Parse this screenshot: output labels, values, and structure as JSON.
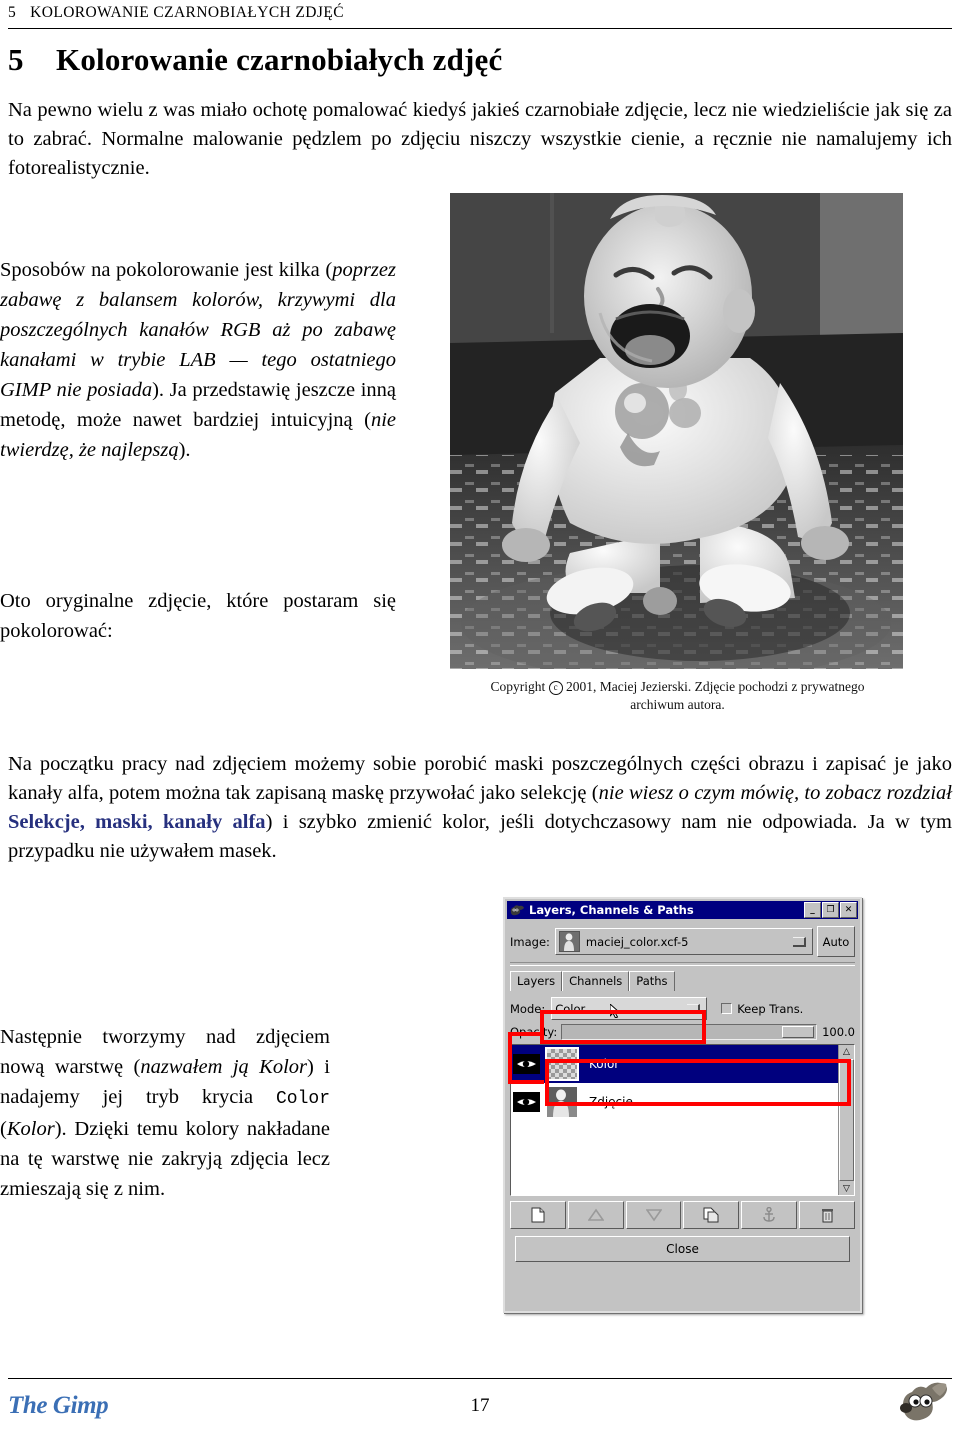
{
  "header": {
    "chapter_number": "5",
    "running_title": "KOLOROWANIE CZARNOBIAŁYCH ZDJĘĆ"
  },
  "section": {
    "number": "5",
    "title": "Kolorowanie czarnobiałych zdjęć"
  },
  "paragraphs": {
    "intro": "Na pewno wielu z was miało ochotę pomalować kiedyś jakieś czarnobiałe zdjęcie, lecz nie wiedzieliście jak się za to zabrać. Normalne malowanie pędzlem po zdjęciu niszczy wszystkie cienie, a ręcznie nie namalujemy ich fotorealistycznie.",
    "sposoby_1": "Sposobów na pokolorowanie jest kilka (",
    "sposoby_italic_1": "poprzez zabawę z balansem kolorów, krzywymi dla poszczególnych kanałów RGB aż po zabawę kanałami w trybie LAB — tego ostatniego GIMP nie posiada",
    "sposoby_2": "). Ja przedstawię jeszcze inną metodę, może nawet bardziej intuicyjną (",
    "sposoby_italic_2": "nie twierdzę, że najlepszą",
    "sposoby_3": ").",
    "oto": "Oto oryginalne zdjęcie, które postaram się pokolorować:",
    "maski_1": "Na początku pracy nad zdjęciem możemy sobie porobić maski poszczególnych części obrazu i zapisać je jako kanały alfa, potem można tak zapisaną maskę przywołać jako selekcję (",
    "maski_italic_1": "nie wiesz o czym mówię, to zobacz rozdział ",
    "maski_xref": "Selekcje, maski, kanały alfa",
    "maski_2": ") i szybko zmienić kolor, jeśli dotychczasowy nam nie odpowiada. Ja w tym przypadku nie używałem masek.",
    "nastepnie_1": "Następnie tworzymy nad zdjęciem nową warstwę (",
    "nastepnie_italic_1": "nazwałem ją Kolor",
    "nastepnie_2": ") i nadajemy jej tryb krycia ",
    "nastepnie_mono": "Color",
    "nastepnie_3": " (",
    "nastepnie_italic_2": "Kolor",
    "nastepnie_4": "). Dzięki temu kolory nakładane na tę warstwę nie zakryją zdjęcia lecz zmieszają się z nim."
  },
  "photo": {
    "alt": "Czarno-białe zdjęcie płaczącego niemowlęcia siedzącego na dywanie",
    "caption_line1_pre": "Copyright ",
    "caption_line1_post": " 2001, Maciej Jezierski. Zdjęcie pochodzi z prywatnego",
    "caption_line2": "archiwum autora.",
    "copyright_symbol": "c"
  },
  "gimp_dialog": {
    "title": "Layers, Channels & Paths",
    "title_buttons": [
      "_",
      "❐",
      "✕"
    ],
    "image_label": "Image:",
    "image_value": "maciej_color.xcf-5",
    "auto_button": "Auto",
    "tabs": [
      "Layers",
      "Channels",
      "Paths"
    ],
    "active_tab": "Layers",
    "mode_label": "Mode:",
    "mode_value": "Color",
    "keep_trans_label": "Keep Trans.",
    "keep_trans_checked": false,
    "opacity_label": "Opacity:",
    "opacity_value": "100.0",
    "layers": [
      {
        "name": "Kolor",
        "visible": true,
        "selected": true,
        "thumb": "transparent"
      },
      {
        "name": "Zdjęcie",
        "visible": true,
        "selected": false,
        "thumb": "photo"
      }
    ],
    "toolbar_icons": [
      "new-layer-icon",
      "raise-layer-icon",
      "lower-layer-icon",
      "duplicate-layer-icon",
      "anchor-layer-icon",
      "delete-layer-icon"
    ],
    "close_button": "Close"
  },
  "footer": {
    "brand": "The Gimp",
    "page_number": "17",
    "mascot": "wilber-icon"
  },
  "colors": {
    "xref_blue": "#26307e",
    "brand_blue": "#3b6fb5",
    "annotation_red": "#ff0000",
    "titlebar_blue": "#000080",
    "layer_select_blue": "#00007e",
    "dialog_grey": "#c3c3c3"
  }
}
